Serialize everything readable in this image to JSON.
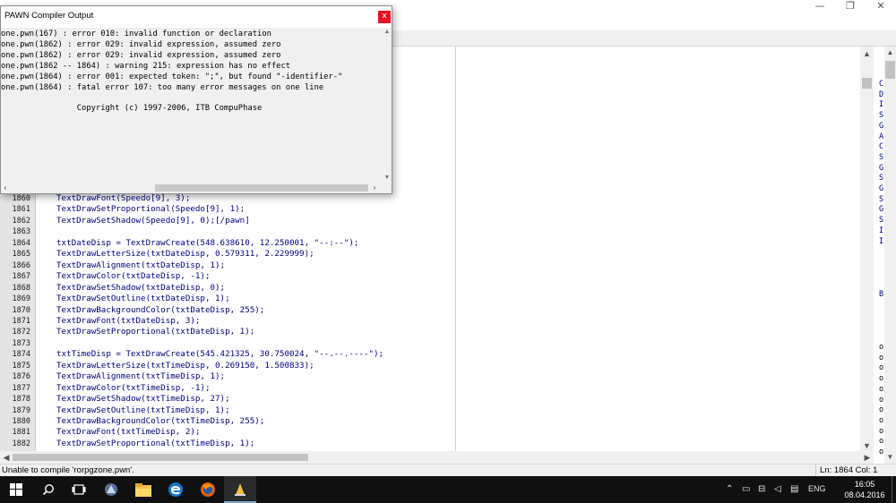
{
  "window": {
    "minimize_glyph": "—",
    "restore_glyph": "❐",
    "close_glyph": "✕"
  },
  "dialog": {
    "title": "PAWN Compiler Output",
    "close_glyph": "x",
    "lines": [
      "one.pwn(167) : error 010: invalid function or declaration",
      "one.pwn(1862) : error 029: invalid expression, assumed zero",
      "one.pwn(1862) : error 029: invalid expression, assumed zero",
      "one.pwn(1862 -- 1864) : warning 215: expression has no effect",
      "one.pwn(1864) : error 001: expected token: \";\", but found \"-identifier-\"",
      "one.pwn(1864) : fatal error 107: too many error messages on one line",
      "",
      "                Copyright (c) 1997-2006, ITB CompuPhase"
    ]
  },
  "editor": {
    "lines": [
      {
        "num": "1860",
        "code": "TextDrawFont(Speedo[9], 3);"
      },
      {
        "num": "1861",
        "code": "TextDrawSetProportional(Speedo[9], 1);"
      },
      {
        "num": "1862",
        "code": "TextDrawSetShadow(Speedo[9], 0);[/pawn]"
      },
      {
        "num": "1863",
        "code": ""
      },
      {
        "num": "1864",
        "code": "txtDateDisp = TextDrawCreate(548.638610, 12.250001, \"--:--\");"
      },
      {
        "num": "1865",
        "code": "TextDrawLetterSize(txtDateDisp, 0.579311, 2.229999);"
      },
      {
        "num": "1866",
        "code": "TextDrawAlignment(txtDateDisp, 1);"
      },
      {
        "num": "1867",
        "code": "TextDrawColor(txtDateDisp, -1);"
      },
      {
        "num": "1868",
        "code": "TextDrawSetShadow(txtDateDisp, 0);"
      },
      {
        "num": "1869",
        "code": "TextDrawSetOutline(txtDateDisp, 1);"
      },
      {
        "num": "1870",
        "code": "TextDrawBackgroundColor(txtDateDisp, 255);"
      },
      {
        "num": "1871",
        "code": "TextDrawFont(txtDateDisp, 3);"
      },
      {
        "num": "1872",
        "code": "TextDrawSetProportional(txtDateDisp, 1);"
      },
      {
        "num": "1873",
        "code": ""
      },
      {
        "num": "1874",
        "code": "txtTimeDisp = TextDrawCreate(545.421325, 30.750024, \"--.--.----\");"
      },
      {
        "num": "1875",
        "code": "TextDrawLetterSize(txtTimeDisp, 0.269150, 1.500833);"
      },
      {
        "num": "1876",
        "code": "TextDrawAlignment(txtTimeDisp, 1);"
      },
      {
        "num": "1877",
        "code": "TextDrawColor(txtTimeDisp, -1);"
      },
      {
        "num": "1878",
        "code": "TextDrawSetShadow(txtTimeDisp, 27);"
      },
      {
        "num": "1879",
        "code": "TextDrawSetOutline(txtTimeDisp, 1);"
      },
      {
        "num": "1880",
        "code": "TextDrawBackgroundColor(txtTimeDisp, 255);"
      },
      {
        "num": "1881",
        "code": "TextDrawFont(txtTimeDisp, 2);"
      },
      {
        "num": "1882",
        "code": "TextDrawSetProportional(txtTimeDisp, 1);"
      }
    ]
  },
  "right_panel": {
    "letters": [
      "C",
      "D",
      "I",
      "S",
      "G",
      "A",
      "C",
      "S",
      "G",
      "S",
      "G",
      "S",
      "G",
      "S",
      "I",
      "I"
    ],
    "b_letter": "B",
    "o_letters": [
      "o",
      "o",
      "o",
      "o",
      "o",
      "o",
      "o",
      "o",
      "o",
      "o",
      "o"
    ]
  },
  "statusbar": {
    "message": "Unable to compile 'rorpgzone.pwn'.",
    "position": "Ln: 1864  Col: 1"
  },
  "taskbar": {
    "apps": [
      {
        "name": "start-button",
        "icon": "windows-logo-icon"
      },
      {
        "name": "search-button",
        "icon": "search-icon"
      },
      {
        "name": "task-view-button",
        "icon": "task-view-icon"
      },
      {
        "name": "app-pawno",
        "icon": "pawno-icon"
      },
      {
        "name": "app-file-explorer",
        "icon": "folder-icon"
      },
      {
        "name": "app-edge",
        "icon": "edge-icon"
      },
      {
        "name": "app-firefox",
        "icon": "firefox-icon"
      },
      {
        "name": "app-pawn-compiler",
        "icon": "pawn-compiler-icon"
      }
    ],
    "language": "ENG",
    "time": "16:05",
    "date": "08.04.2016"
  }
}
